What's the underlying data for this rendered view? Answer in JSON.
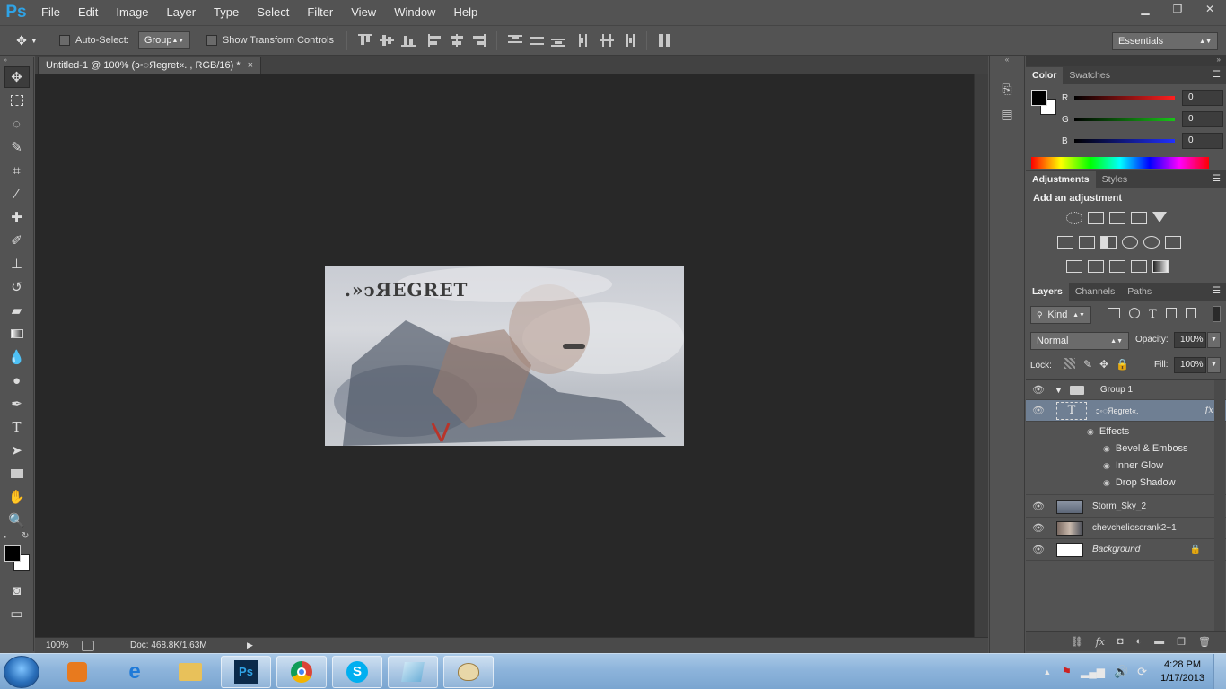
{
  "app": {
    "logo": "Ps",
    "menus": [
      "File",
      "Edit",
      "Image",
      "Layer",
      "Type",
      "Select",
      "Filter",
      "View",
      "Window",
      "Help"
    ],
    "window_controls": [
      "minimize-icon",
      "restore-icon",
      "close-icon"
    ]
  },
  "options": {
    "auto_select_label": "Auto-Select:",
    "auto_select_value": "Group",
    "transform_label": "Show Transform Controls",
    "workspace": "Essentials"
  },
  "document": {
    "tab_title": "Untitled-1 @ 100%  (ↄ◦◌Яegret«. , RGB/16) *",
    "close": "×",
    "art_title": ".»ↄЯEGRET",
    "zoom": "100%",
    "doc_info": "Doc: 468.8K/1.63M"
  },
  "color_panel": {
    "tabs": [
      "Color",
      "Swatches"
    ],
    "channels": [
      {
        "letter": "R",
        "value": "0",
        "color": "#ff2020"
      },
      {
        "letter": "G",
        "value": "0",
        "color": "#19c419"
      },
      {
        "letter": "B",
        "value": "0",
        "color": "#2030ff"
      }
    ]
  },
  "adjustments_panel": {
    "tabs": [
      "Adjustments",
      "Styles"
    ],
    "heading": "Add an adjustment"
  },
  "layers_panel": {
    "tabs": [
      "Layers",
      "Channels",
      "Paths"
    ],
    "kind_label": "Kind",
    "blend_mode": "Normal",
    "opacity_label": "Opacity:",
    "opacity_value": "100%",
    "lock_label": "Lock:",
    "fill_label": "Fill:",
    "fill_value": "100%",
    "group_name": "Group 1",
    "text_layer_name": "ↄ◦◌Яegret«.",
    "fx_label": "fx",
    "effects_label": "Effects",
    "effects": [
      "Bevel & Emboss",
      "Inner Glow",
      "Drop Shadow"
    ],
    "layers": [
      {
        "name": "Storm_Sky_2"
      },
      {
        "name": "chevcheliosсrank2~1"
      },
      {
        "name": "Background"
      }
    ]
  },
  "taskbar": {
    "time": "4:28 PM",
    "date": "1/17/2013"
  }
}
